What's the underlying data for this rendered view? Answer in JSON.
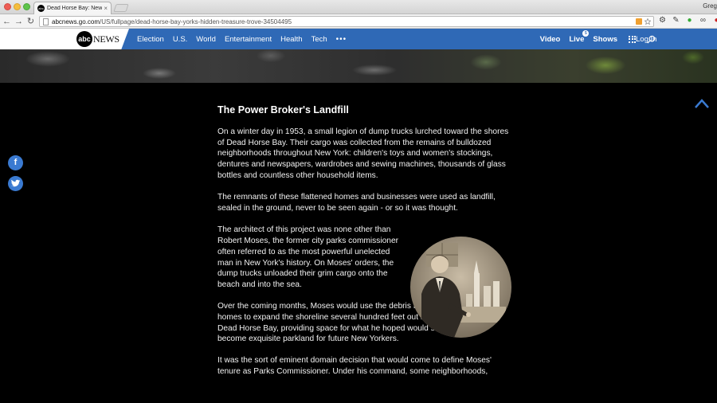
{
  "browser": {
    "tab_title": "Dead Horse Bay: New York",
    "tab_close": "×",
    "profile_name": "Greg",
    "url_host": "abcnews.go.com",
    "url_path": "/US/fullpage/dead-horse-bay-yorks-hidden-treasure-trove-34504495",
    "icons": [
      "back-icon",
      "forward-icon",
      "reload-icon",
      "bookmark-star-icon",
      "settings-icon"
    ]
  },
  "header": {
    "logo_abc": "abc",
    "logo_news": "NEWS",
    "nav": [
      "Election",
      "U.S.",
      "World",
      "Entertainment",
      "Health",
      "Tech"
    ],
    "more": "•••",
    "video": "Video",
    "live": "Live",
    "live_badge": "5",
    "shows": "Shows",
    "login": "Log In",
    "accent": "#2f69b6"
  },
  "article": {
    "heading": "The Power Broker's Landfill",
    "paragraphs": [
      "On a winter day in 1953, a small legion of dump trucks lurched toward the shores of Dead Horse Bay. Their cargo was collected from the remains of bulldozed neighborhoods throughout New York: children's toys and women's stockings, dentures and newspapers, wardrobes and sewing machines, thousands of glass bottles and countless other household items.",
      "The remnants of these flattened homes and businesses were used as landfill, sealed in the ground, never to be seen again - or so it was thought.",
      "The architect of this project was none other than Robert Moses, the former city parks commissioner often referred to as the most powerful unelected man in New York's history. On Moses' orders, the dump trucks unloaded their grim cargo onto the beach and into the sea.",
      "Over the coming months, Moses would use the debris from destroyed homes to expand the shoreline several hundred feet out into the waters of Dead Horse Bay, providing space for what he hoped would someday become exquisite parkland for future New Yorkers.",
      "It was the sort of eminent domain decision that would come to define Moses' tenure as Parks Commissioner. Under his command, some neighborhoods,"
    ]
  },
  "share": {
    "facebook": "f"
  }
}
